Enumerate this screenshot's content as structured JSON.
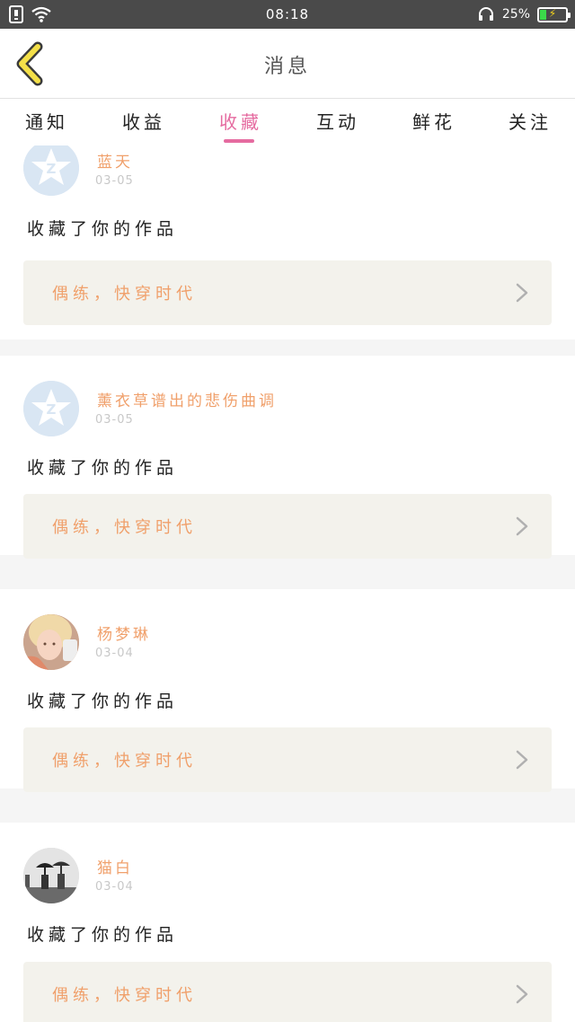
{
  "status_bar": {
    "time": "08:18",
    "battery_percent": "25%",
    "battery_level": 0.25,
    "icons": [
      "sim-icon",
      "wifi-icon",
      "headset-icon",
      "battery-icon"
    ]
  },
  "header": {
    "title": "消息",
    "back_icon": "chevron-left-icon"
  },
  "tabs": [
    {
      "label": "通知"
    },
    {
      "label": "收益"
    },
    {
      "label": "收藏"
    },
    {
      "label": "互动"
    },
    {
      "label": "鲜花"
    },
    {
      "label": "关注"
    }
  ],
  "active_tab": "收藏",
  "colors": {
    "accent": "#e56ba0",
    "username": "#f0a06b",
    "work_bg": "#f3f2ec"
  },
  "messages": [
    {
      "user": "蓝天",
      "date": "03-05",
      "action": "收藏了你的作品",
      "work": "偶练，快穿时代",
      "avatar": "qq-default-avatar"
    },
    {
      "user": "薰衣草谱出的悲伤曲调",
      "date": "03-05",
      "action": "收藏了你的作品",
      "work": "偶练，快穿时代",
      "avatar": "qq-default-avatar"
    },
    {
      "user": "杨梦琳",
      "date": "03-04",
      "action": "收藏了你的作品",
      "work": "偶练，快穿时代",
      "avatar": "photo-avatar-girl"
    },
    {
      "user": "猫白",
      "date": "03-04",
      "action": "收藏了你的作品",
      "work": "偶练，快穿时代",
      "avatar": "photo-avatar-umbrella"
    }
  ]
}
